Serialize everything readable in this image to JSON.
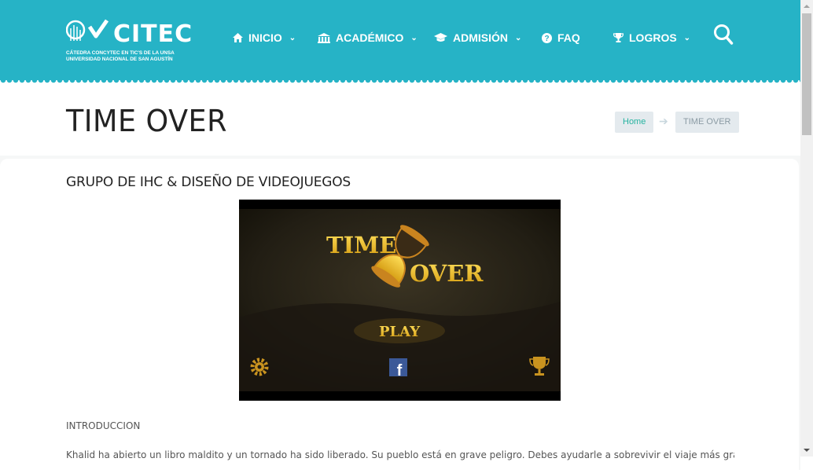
{
  "header": {
    "logo_text": "CITEC",
    "logo_sub_line1": "CÁTEDRA CONCYTEC EN TIC'S DE LA UNSA",
    "logo_sub_line2": "UNIVERSIDAD NACIONAL DE SAN AGUSTÍN",
    "nav": [
      {
        "label": "INICIO",
        "icon": "home-icon",
        "dropdown": true
      },
      {
        "label": "ACADÉMICO",
        "icon": "institution-icon",
        "dropdown": true
      },
      {
        "label": "ADMISIÓN",
        "icon": "graduation-cap-icon",
        "dropdown": true
      },
      {
        "label": "FAQ",
        "icon": "question-circle-icon",
        "dropdown": false
      },
      {
        "label": "LOGROS",
        "icon": "trophy-icon",
        "dropdown": true
      }
    ],
    "chevron": "⌄"
  },
  "page": {
    "title": "TIME OVER",
    "breadcrumb": {
      "home": "Home",
      "arrow": "➔",
      "current": "TIME OVER"
    }
  },
  "content": {
    "heading": "GRUPO DE IHC & DISEÑO DE VIDEOJUEGOS",
    "game_title_1": "TIME",
    "game_title_2": "OVER",
    "play_label": "PLAY",
    "facebook_letter": "f",
    "intro_label": "INTRODUCCION",
    "body": "Khalid ha abierto un libro maldito y un tornado ha sido liberado. Su pueblo está en grave peligro. Debes ayudarle a sobrevivir el viaje más grande para"
  },
  "colors": {
    "header": "#26b3c6",
    "accent_link": "#26b3a0",
    "crumb_bg": "#e4eaee"
  }
}
